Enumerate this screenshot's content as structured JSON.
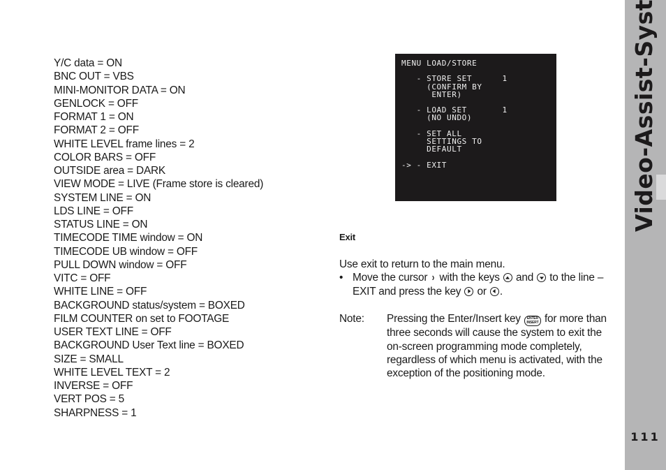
{
  "settings_list": [
    "Y/C data = ON",
    "BNC OUT = VBS",
    "MINI-MONITOR DATA = ON",
    "GENLOCK = OFF",
    "FORMAT 1 = ON",
    "FORMAT 2 = OFF",
    "WHITE LEVEL frame lines = 2",
    "COLOR BARS = OFF",
    "OUTSIDE area = DARK",
    "VIEW MODE = LIVE (Frame store is cleared)",
    "SYSTEM LINE = ON",
    "LDS LINE = OFF",
    "STATUS LINE = ON",
    "TIMECODE TIME window = ON",
    "TIMECODE UB window = OFF",
    "PULL DOWN window = OFF",
    "VITC = OFF",
    "WHITE LINE = OFF",
    "BACKGROUND status/system = BOXED",
    "FILM COUNTER on set to FOOTAGE",
    "USER TEXT LINE = OFF",
    "BACKGROUND User Text line = BOXED",
    "SIZE = SMALL",
    "WHITE LEVEL TEXT = 2",
    "INVERSE = OFF",
    "VERT POS = 5",
    "SHARPNESS = 1"
  ],
  "osd_menu": {
    "title": "MENU LOAD/STORE",
    "text": "MENU LOAD/STORE\n\n   - STORE SET      1\n     (CONFIRM BY\n      ENTER)\n\n   - LOAD SET       1\n     (NO UNDO)\n\n   - SET ALL\n     SETTINGS TO\n     DEFAULT\n\n-> - EXIT"
  },
  "section": {
    "title": "Exit",
    "intro": "Use exit to return to the main menu.",
    "bullet": "•",
    "step_part1": "Move the cursor",
    "step_part2": "with the keys",
    "step_part3": "and",
    "step_part4": "to the line –EXIT and press the key",
    "step_part5": "or",
    "step_part6": ".",
    "cursor_glyph": "›",
    "note_label": "Note:",
    "note_part1": "Pressing the Enter/Insert key",
    "note_part2": "for more than three seconds will cause the system to exit the on-screen programming mode completely, regardless of which menu is activated, with the exception of the positioning mode.",
    "enter_key_line1": "ENTER",
    "enter_key_line2": "INSERT"
  },
  "sidebar": {
    "title": "Video-Assist-System",
    "page_number": "111"
  },
  "colors": {
    "sidebar_bg": "#b5b5b6",
    "osd_bg": "#1c1a1b",
    "osd_text": "#f2f2f2"
  }
}
